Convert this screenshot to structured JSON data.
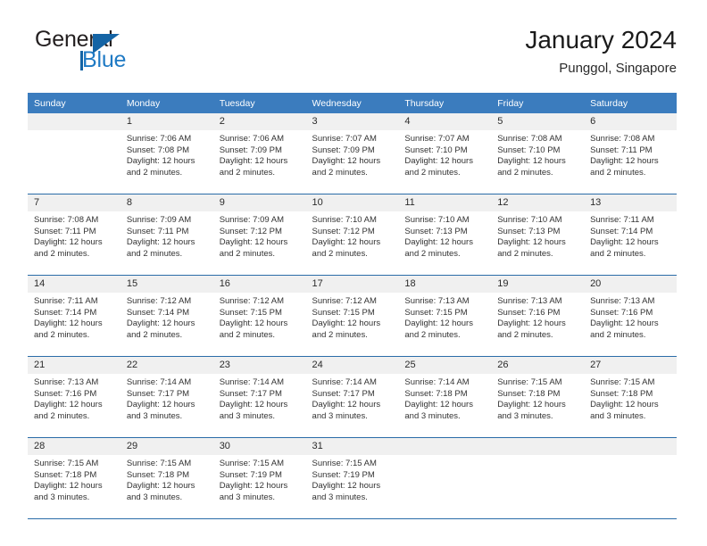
{
  "brand": {
    "name_part1": "General",
    "name_part2": "Blue",
    "logo_icon": "triangle-flag-icon"
  },
  "header": {
    "title": "January 2024",
    "location": "Punggol, Singapore"
  },
  "theme": {
    "header_blue": "#3b7cbe",
    "rule_blue": "#2a6ca8",
    "daynum_bg": "#f0f0f0",
    "brand_blue": "#1f7ac4"
  },
  "weekdays": [
    "Sunday",
    "Monday",
    "Tuesday",
    "Wednesday",
    "Thursday",
    "Friday",
    "Saturday"
  ],
  "weeks": [
    [
      {
        "day": "",
        "lines": []
      },
      {
        "day": "1",
        "lines": [
          "Sunrise: 7:06 AM",
          "Sunset: 7:08 PM",
          "Daylight: 12 hours",
          "and 2 minutes."
        ]
      },
      {
        "day": "2",
        "lines": [
          "Sunrise: 7:06 AM",
          "Sunset: 7:09 PM",
          "Daylight: 12 hours",
          "and 2 minutes."
        ]
      },
      {
        "day": "3",
        "lines": [
          "Sunrise: 7:07 AM",
          "Sunset: 7:09 PM",
          "Daylight: 12 hours",
          "and 2 minutes."
        ]
      },
      {
        "day": "4",
        "lines": [
          "Sunrise: 7:07 AM",
          "Sunset: 7:10 PM",
          "Daylight: 12 hours",
          "and 2 minutes."
        ]
      },
      {
        "day": "5",
        "lines": [
          "Sunrise: 7:08 AM",
          "Sunset: 7:10 PM",
          "Daylight: 12 hours",
          "and 2 minutes."
        ]
      },
      {
        "day": "6",
        "lines": [
          "Sunrise: 7:08 AM",
          "Sunset: 7:11 PM",
          "Daylight: 12 hours",
          "and 2 minutes."
        ]
      }
    ],
    [
      {
        "day": "7",
        "lines": [
          "Sunrise: 7:08 AM",
          "Sunset: 7:11 PM",
          "Daylight: 12 hours",
          "and 2 minutes."
        ]
      },
      {
        "day": "8",
        "lines": [
          "Sunrise: 7:09 AM",
          "Sunset: 7:11 PM",
          "Daylight: 12 hours",
          "and 2 minutes."
        ]
      },
      {
        "day": "9",
        "lines": [
          "Sunrise: 7:09 AM",
          "Sunset: 7:12 PM",
          "Daylight: 12 hours",
          "and 2 minutes."
        ]
      },
      {
        "day": "10",
        "lines": [
          "Sunrise: 7:10 AM",
          "Sunset: 7:12 PM",
          "Daylight: 12 hours",
          "and 2 minutes."
        ]
      },
      {
        "day": "11",
        "lines": [
          "Sunrise: 7:10 AM",
          "Sunset: 7:13 PM",
          "Daylight: 12 hours",
          "and 2 minutes."
        ]
      },
      {
        "day": "12",
        "lines": [
          "Sunrise: 7:10 AM",
          "Sunset: 7:13 PM",
          "Daylight: 12 hours",
          "and 2 minutes."
        ]
      },
      {
        "day": "13",
        "lines": [
          "Sunrise: 7:11 AM",
          "Sunset: 7:14 PM",
          "Daylight: 12 hours",
          "and 2 minutes."
        ]
      }
    ],
    [
      {
        "day": "14",
        "lines": [
          "Sunrise: 7:11 AM",
          "Sunset: 7:14 PM",
          "Daylight: 12 hours",
          "and 2 minutes."
        ]
      },
      {
        "day": "15",
        "lines": [
          "Sunrise: 7:12 AM",
          "Sunset: 7:14 PM",
          "Daylight: 12 hours",
          "and 2 minutes."
        ]
      },
      {
        "day": "16",
        "lines": [
          "Sunrise: 7:12 AM",
          "Sunset: 7:15 PM",
          "Daylight: 12 hours",
          "and 2 minutes."
        ]
      },
      {
        "day": "17",
        "lines": [
          "Sunrise: 7:12 AM",
          "Sunset: 7:15 PM",
          "Daylight: 12 hours",
          "and 2 minutes."
        ]
      },
      {
        "day": "18",
        "lines": [
          "Sunrise: 7:13 AM",
          "Sunset: 7:15 PM",
          "Daylight: 12 hours",
          "and 2 minutes."
        ]
      },
      {
        "day": "19",
        "lines": [
          "Sunrise: 7:13 AM",
          "Sunset: 7:16 PM",
          "Daylight: 12 hours",
          "and 2 minutes."
        ]
      },
      {
        "day": "20",
        "lines": [
          "Sunrise: 7:13 AM",
          "Sunset: 7:16 PM",
          "Daylight: 12 hours",
          "and 2 minutes."
        ]
      }
    ],
    [
      {
        "day": "21",
        "lines": [
          "Sunrise: 7:13 AM",
          "Sunset: 7:16 PM",
          "Daylight: 12 hours",
          "and 2 minutes."
        ]
      },
      {
        "day": "22",
        "lines": [
          "Sunrise: 7:14 AM",
          "Sunset: 7:17 PM",
          "Daylight: 12 hours",
          "and 3 minutes."
        ]
      },
      {
        "day": "23",
        "lines": [
          "Sunrise: 7:14 AM",
          "Sunset: 7:17 PM",
          "Daylight: 12 hours",
          "and 3 minutes."
        ]
      },
      {
        "day": "24",
        "lines": [
          "Sunrise: 7:14 AM",
          "Sunset: 7:17 PM",
          "Daylight: 12 hours",
          "and 3 minutes."
        ]
      },
      {
        "day": "25",
        "lines": [
          "Sunrise: 7:14 AM",
          "Sunset: 7:18 PM",
          "Daylight: 12 hours",
          "and 3 minutes."
        ]
      },
      {
        "day": "26",
        "lines": [
          "Sunrise: 7:15 AM",
          "Sunset: 7:18 PM",
          "Daylight: 12 hours",
          "and 3 minutes."
        ]
      },
      {
        "day": "27",
        "lines": [
          "Sunrise: 7:15 AM",
          "Sunset: 7:18 PM",
          "Daylight: 12 hours",
          "and 3 minutes."
        ]
      }
    ],
    [
      {
        "day": "28",
        "lines": [
          "Sunrise: 7:15 AM",
          "Sunset: 7:18 PM",
          "Daylight: 12 hours",
          "and 3 minutes."
        ]
      },
      {
        "day": "29",
        "lines": [
          "Sunrise: 7:15 AM",
          "Sunset: 7:18 PM",
          "Daylight: 12 hours",
          "and 3 minutes."
        ]
      },
      {
        "day": "30",
        "lines": [
          "Sunrise: 7:15 AM",
          "Sunset: 7:19 PM",
          "Daylight: 12 hours",
          "and 3 minutes."
        ]
      },
      {
        "day": "31",
        "lines": [
          "Sunrise: 7:15 AM",
          "Sunset: 7:19 PM",
          "Daylight: 12 hours",
          "and 3 minutes."
        ]
      },
      {
        "day": "",
        "lines": []
      },
      {
        "day": "",
        "lines": []
      },
      {
        "day": "",
        "lines": []
      }
    ]
  ]
}
